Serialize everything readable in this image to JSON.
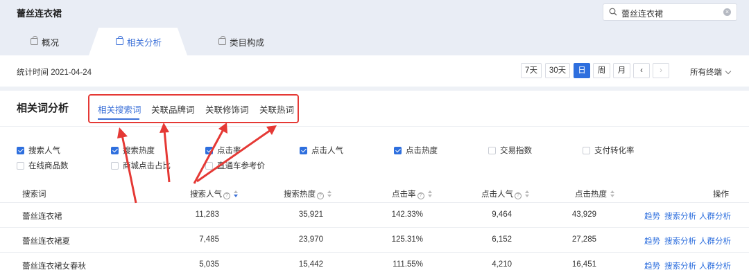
{
  "header": {
    "title": "蕾丝连衣裙",
    "search_value": "蕾丝连衣裙",
    "tabs": [
      {
        "label": "概况",
        "active": false
      },
      {
        "label": "相关分析",
        "active": true
      },
      {
        "label": "类目构成",
        "active": false
      }
    ]
  },
  "datebar": {
    "stat_date": "统计时间 2021-04-24",
    "buttons": [
      {
        "label": "7天",
        "active": false
      },
      {
        "label": "30天",
        "active": false
      },
      {
        "label": "日",
        "active": true
      },
      {
        "label": "周",
        "active": false
      },
      {
        "label": "月",
        "active": false
      }
    ],
    "prev": "‹",
    "next": "›",
    "terminal": "所有终端"
  },
  "panel": {
    "title": "相关词分析",
    "subtabs": [
      {
        "label": "相关搜索词",
        "active": true
      },
      {
        "label": "关联品牌词",
        "active": false
      },
      {
        "label": "关联修饰词",
        "active": false
      },
      {
        "label": "关联热词",
        "active": false
      }
    ],
    "metrics": [
      {
        "label": "搜索人气",
        "checked": true
      },
      {
        "label": "搜索热度",
        "checked": true
      },
      {
        "label": "点击率",
        "checked": true
      },
      {
        "label": "点击人气",
        "checked": true
      },
      {
        "label": "点击热度",
        "checked": true
      },
      {
        "label": "交易指数",
        "checked": false
      },
      {
        "label": "支付转化率",
        "checked": false
      },
      {
        "label": "在线商品数",
        "checked": false
      },
      {
        "label": "商城点击占比",
        "checked": false
      },
      {
        "label": "直通车参考价",
        "checked": false
      }
    ],
    "columns": [
      "搜索词",
      "搜索人气",
      "搜索热度",
      "点击率",
      "点击人气",
      "点击热度",
      "操作"
    ],
    "rows": [
      {
        "keyword": "蕾丝连衣裙",
        "search_pop": "11,283",
        "search_heat": "35,921",
        "ctr": "142.33%",
        "click_pop": "9,464",
        "click_heat": "43,929"
      },
      {
        "keyword": "蕾丝连衣裙夏",
        "search_pop": "7,485",
        "search_heat": "23,970",
        "ctr": "125.31%",
        "click_pop": "6,152",
        "click_heat": "27,285"
      },
      {
        "keyword": "蕾丝连衣裙女春秋",
        "search_pop": "5,035",
        "search_heat": "15,442",
        "ctr": "111.55%",
        "click_pop": "4,210",
        "click_heat": "16,451"
      }
    ],
    "actions": [
      "趋势",
      "搜索分析",
      "人群分析"
    ]
  },
  "colors": {
    "accent": "#2e6fde",
    "highlight": "#e53935"
  }
}
